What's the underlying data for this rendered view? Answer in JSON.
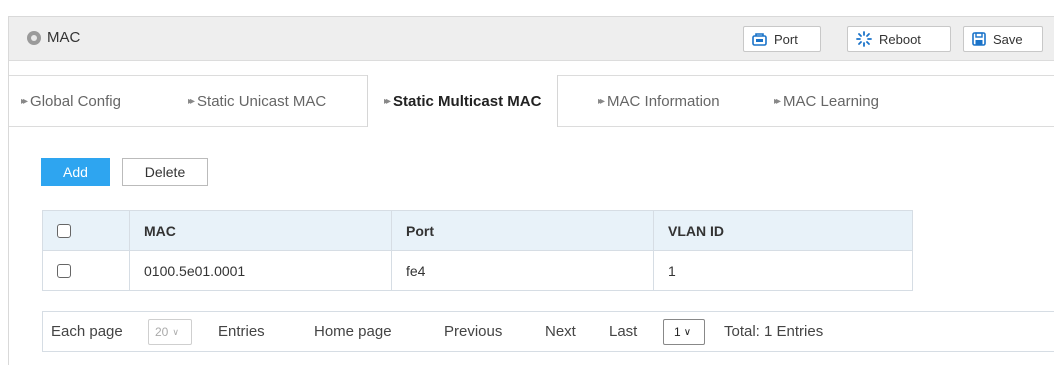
{
  "header": {
    "title": "MAC",
    "port_label": "Port",
    "reboot_label": "Reboot",
    "save_label": "Save"
  },
  "tabs": [
    {
      "label": "Global Config",
      "active": false
    },
    {
      "label": "Static Unicast MAC",
      "active": false
    },
    {
      "label": "Static Multicast MAC",
      "active": true
    },
    {
      "label": "MAC Information",
      "active": false
    },
    {
      "label": "MAC Learning",
      "active": false
    }
  ],
  "actions": {
    "add_label": "Add",
    "delete_label": "Delete"
  },
  "table": {
    "columns": [
      "MAC",
      "Port",
      "VLAN ID"
    ],
    "rows": [
      {
        "mac": "0100.5e01.0001",
        "port": "fe4",
        "vlan": "1"
      }
    ]
  },
  "pager": {
    "each_page": "Each page",
    "page_size": "20",
    "entries": "Entries",
    "home": "Home page",
    "previous": "Previous",
    "next": "Next",
    "last": "Last",
    "current_page": "1",
    "total": "Total: 1 Entries"
  },
  "colors": {
    "accent": "#2ea5f0",
    "icon_blue": "#1a73c9",
    "header_bg": "#eeeeee",
    "table_head_bg": "#e8f2f9"
  },
  "icons": {
    "header": "circle-icon",
    "port": "port-icon",
    "reboot": "reboot-icon",
    "save": "save-icon",
    "tab": "double-chevron-right-icon"
  }
}
